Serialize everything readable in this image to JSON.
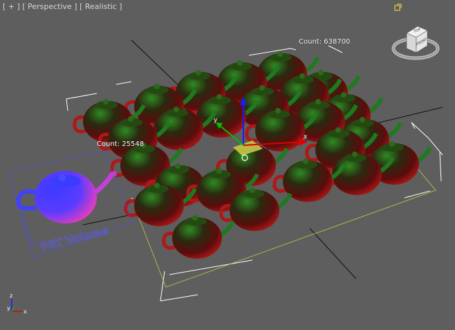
{
  "viewport": {
    "labels": [
      "[ + ]",
      "[ Perspective ]",
      "[ Realistic ]"
    ],
    "maximize_icon": "maximize-viewport-icon"
  },
  "counts": {
    "main": "Count: 638700",
    "volume": "Count: 25548"
  },
  "helper_text": "PRT Volume",
  "gizmo": {
    "x_label": "x",
    "y_label": "y"
  },
  "viewcube": {
    "top": "TOP",
    "front": "FRONT"
  },
  "axis_tripod": {
    "x": "x",
    "y": "y",
    "z": "z"
  },
  "colors": {
    "background": "#5e5e5e",
    "grid": "#000000",
    "bbox": "#ffffff",
    "teapot_red": "#c01818",
    "teapot_green": "#1aa01a",
    "volume_blue": "#3a3aff",
    "gizmo_x": "#e00000",
    "gizmo_y": "#00c000",
    "gizmo_z": "#1a1aff",
    "plane_yellow": "#c8c84a"
  }
}
